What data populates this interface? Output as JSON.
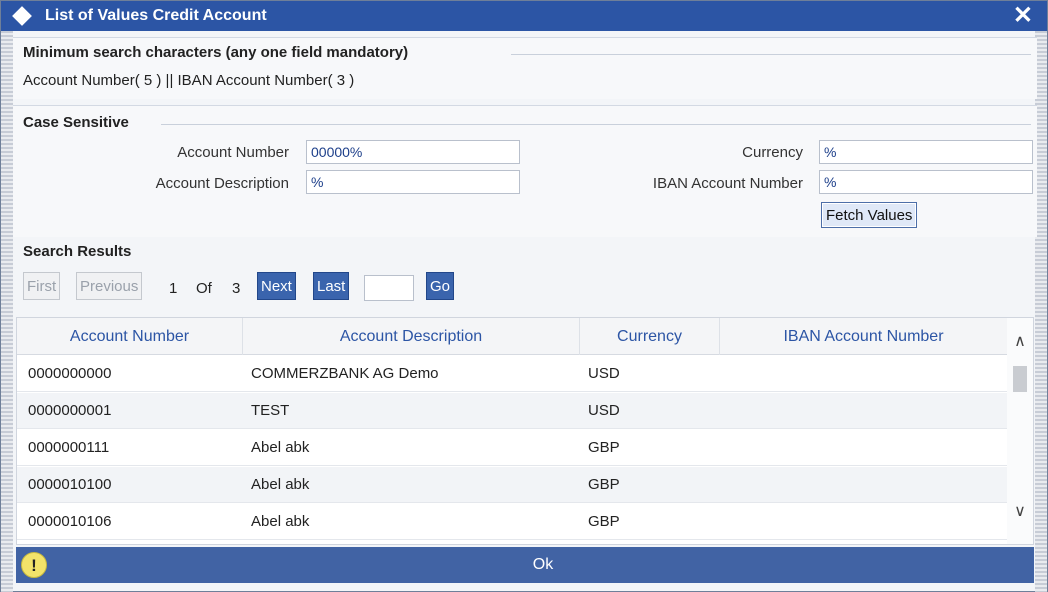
{
  "window": {
    "title": "List of Values Credit Account",
    "close_glyph": "✕",
    "title_icon": "diamond-icon"
  },
  "criteria": {
    "heading": "Minimum search characters (any one field mandatory)",
    "detail": "Account Number( 5 ) || IBAN Account Number( 3 )"
  },
  "search": {
    "heading": "Case Sensitive",
    "account_number_label": "Account Number",
    "account_number_value": "00000%",
    "account_description_label": "Account Description",
    "account_description_value": "%",
    "currency_label": "Currency",
    "currency_value": "%",
    "iban_label": "IBAN Account Number",
    "iban_value": "%",
    "fetch_label": "Fetch Values"
  },
  "results": {
    "heading": "Search Results",
    "first_label": "First",
    "previous_label": "Previous",
    "current_page": "1",
    "of_label": "Of",
    "total_pages": "3",
    "next_label": "Next",
    "last_label": "Last",
    "goto_value": "",
    "go_label": "Go",
    "columns": [
      "Account Number",
      "Account Description",
      "Currency",
      "IBAN Account Number"
    ],
    "rows": [
      [
        "0000000000",
        "COMMERZBANK AG Demo",
        "USD",
        ""
      ],
      [
        "0000000001",
        "TEST",
        "USD",
        ""
      ],
      [
        "0000000111",
        "Abel abk",
        "GBP",
        ""
      ],
      [
        "0000010100",
        "Abel abk",
        "GBP",
        ""
      ],
      [
        "0000010106",
        "Abel abk",
        "GBP",
        ""
      ]
    ]
  },
  "footer": {
    "warning_glyph": "!",
    "ok_label": "Ok"
  },
  "colors": {
    "titlebar": "#2c55a5",
    "header_text": "#2c55a5",
    "footer": "#4163a4",
    "nav_button": "#3a64ad"
  }
}
